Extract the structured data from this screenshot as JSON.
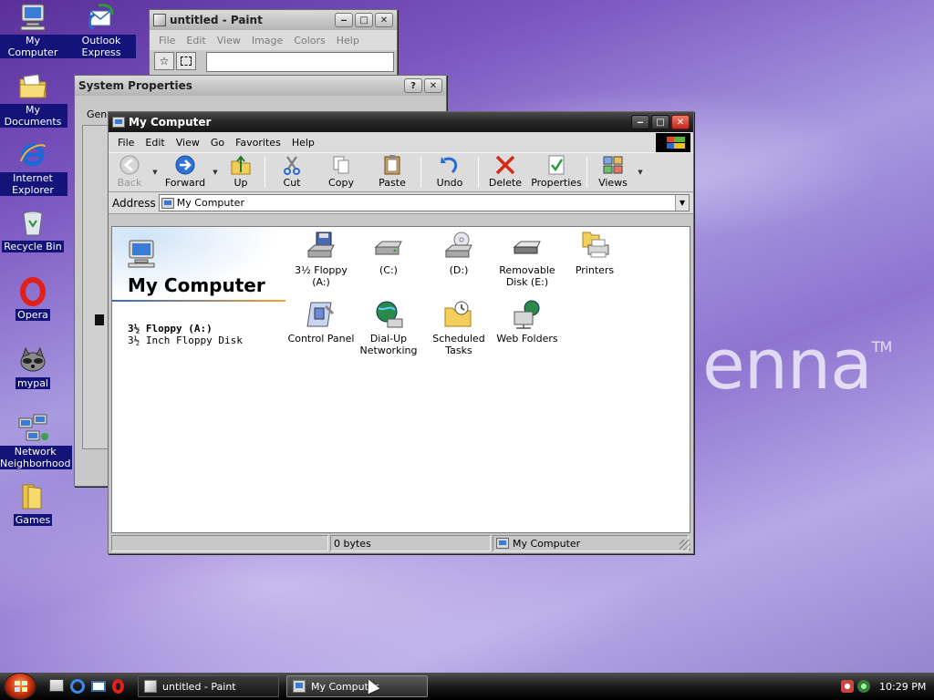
{
  "desktop": {
    "brand_text": "enna",
    "brand_mark": "TM",
    "icons": [
      {
        "label": "My Computer"
      },
      {
        "label": "Outlook Express"
      },
      {
        "label": "My Documents"
      },
      {
        "label": "Internet Explorer"
      },
      {
        "label": "Recycle Bin"
      },
      {
        "label": "Opera"
      },
      {
        "label": "mypal"
      },
      {
        "label": "Network Neighborhood"
      },
      {
        "label": "Games"
      }
    ]
  },
  "paint": {
    "title": "untitled - Paint",
    "menu": [
      "File",
      "Edit",
      "View",
      "Image",
      "Colors",
      "Help"
    ]
  },
  "sysprops": {
    "title": "System Properties",
    "tab_fragment": "Gene",
    "help_btn": "?",
    "close_btn": "✕"
  },
  "explorer": {
    "title": "My Computer",
    "menu": [
      "File",
      "Edit",
      "View",
      "Go",
      "Favorites",
      "Help"
    ],
    "toolbar": {
      "back": "Back",
      "forward": "Forward",
      "up": "Up",
      "cut": "Cut",
      "copy": "Copy",
      "paste": "Paste",
      "undo": "Undo",
      "delete": "Delete",
      "properties": "Properties",
      "views": "Views"
    },
    "address_label": "Address",
    "address_value": "My Computer",
    "panel": {
      "title": "My Computer",
      "selected_name": "3½ Floppy (A:)",
      "selected_desc": "3½ Inch Floppy Disk"
    },
    "items": [
      {
        "label": "3½ Floppy (A:)"
      },
      {
        "label": "(C:)"
      },
      {
        "label": "(D:)"
      },
      {
        "label": "Removable Disk (E:)"
      },
      {
        "label": "Printers"
      },
      {
        "label": "Control Panel"
      },
      {
        "label": "Dial-Up Networking"
      },
      {
        "label": "Scheduled Tasks"
      },
      {
        "label": "Web Folders"
      }
    ],
    "status": {
      "size": "0 bytes",
      "location": "My Computer"
    }
  },
  "taskbar": {
    "tasks": [
      {
        "label": "untitled - Paint"
      },
      {
        "label": "My Computer"
      }
    ],
    "clock": "10:29 PM"
  }
}
